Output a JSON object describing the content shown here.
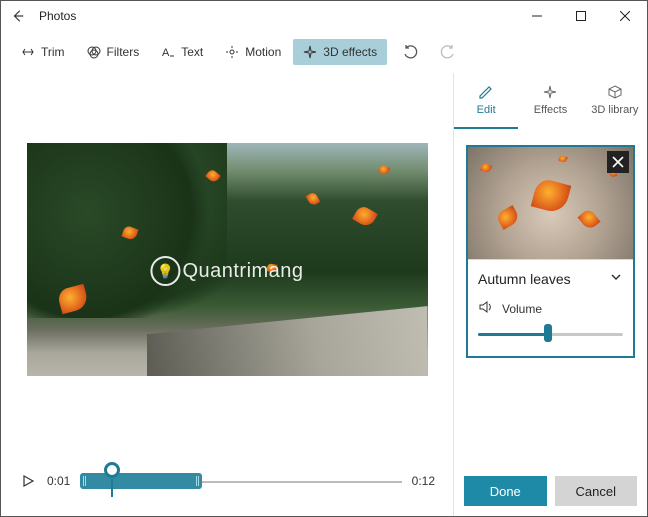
{
  "window": {
    "title": "Photos"
  },
  "toolbar": {
    "trim": "Trim",
    "filters": "Filters",
    "text": "Text",
    "motion": "Motion",
    "effects3d": "3D effects"
  },
  "timeline": {
    "current": "0:01",
    "duration": "0:12"
  },
  "side_tabs": {
    "edit": "Edit",
    "effects": "Effects",
    "library": "3D library"
  },
  "effect": {
    "name": "Autumn leaves",
    "volume_label": "Volume"
  },
  "footer": {
    "done": "Done",
    "cancel": "Cancel"
  },
  "watermark": "Quantrimang"
}
